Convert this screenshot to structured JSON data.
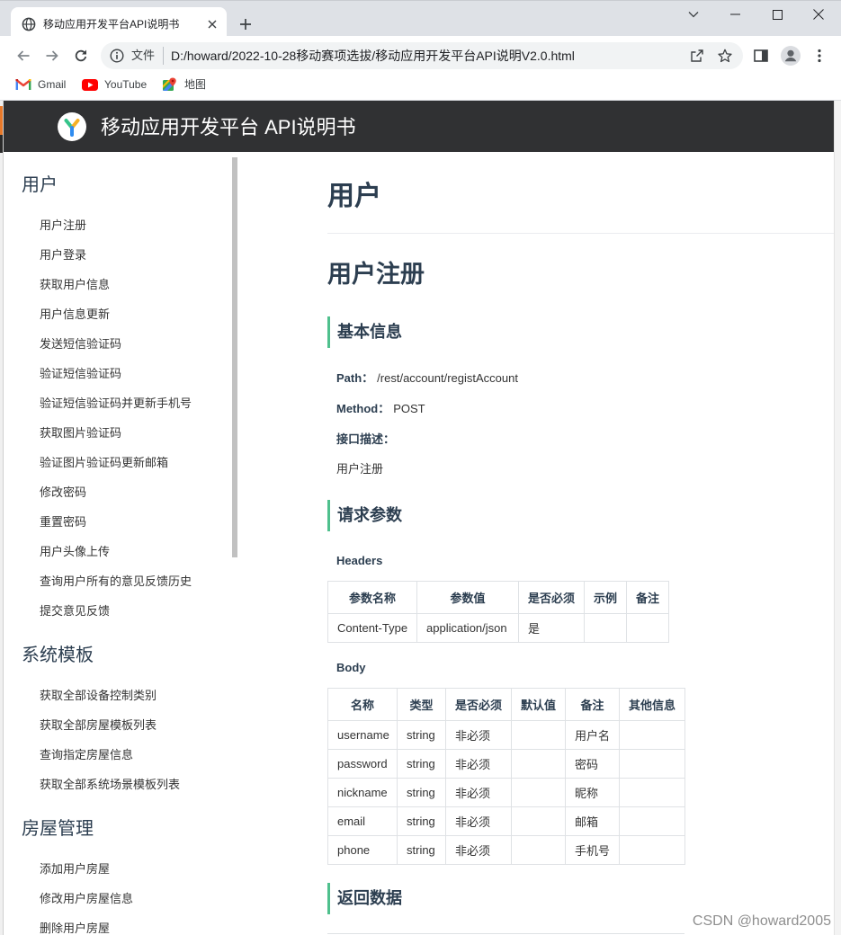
{
  "browser": {
    "tab": {
      "title": "移动应用开发平台API说明书",
      "icon": "globe-icon"
    },
    "address_bar": {
      "scheme_label": "文件",
      "url": "D:/howard/2022-10-28移动赛项选拔/移动应用开发平台API说明V2.0.html"
    },
    "bookmarks": [
      {
        "label": "Gmail",
        "icon": "gmail-icon"
      },
      {
        "label": "YouTube",
        "icon": "youtube-icon"
      },
      {
        "label": "地图",
        "icon": "maps-icon"
      }
    ]
  },
  "header": {
    "title": "移动应用开发平台 API说明书",
    "logo": "yapi-logo-icon"
  },
  "sidebar": {
    "sections": [
      {
        "title": "用户",
        "items": [
          "用户注册",
          "用户登录",
          "获取用户信息",
          "用户信息更新",
          "发送短信验证码",
          "验证短信验证码",
          "验证短信验证码并更新手机号",
          "获取图片验证码",
          "验证图片验证码更新邮箱",
          "修改密码",
          "重置密码",
          "用户头像上传",
          "查询用户所有的意见反馈历史",
          "提交意见反馈"
        ]
      },
      {
        "title": "系统模板",
        "items": [
          "获取全部设备控制类别",
          "获取全部房屋模板列表",
          "查询指定房屋信息",
          "获取全部系统场景模板列表"
        ]
      },
      {
        "title": "房屋管理",
        "items": [
          "添加用户房屋",
          "修改用户房屋信息",
          "删除用户房屋"
        ]
      }
    ]
  },
  "main": {
    "category_title": "用户",
    "api_title": "用户注册",
    "basic_info": {
      "heading": "基本信息",
      "path_label": "Path：",
      "path": "/rest/account/registAccount",
      "method_label": "Method：",
      "method": "POST",
      "desc_label": "接口描述：",
      "desc": "用户注册"
    },
    "request": {
      "heading": "请求参数",
      "headers_label": "Headers",
      "headers_table": {
        "columns": [
          "参数名称",
          "参数值",
          "是否必须",
          "示例",
          "备注"
        ],
        "rows": [
          [
            "Content-Type",
            "application/json",
            "是",
            "",
            ""
          ]
        ]
      },
      "body_label": "Body",
      "body_table": {
        "columns": [
          "名称",
          "类型",
          "是否必须",
          "默认值",
          "备注",
          "其他信息"
        ],
        "rows": [
          [
            "username",
            "string",
            "非必须",
            "",
            "用户名",
            ""
          ],
          [
            "password",
            "string",
            "非必须",
            "",
            "密码",
            ""
          ],
          [
            "nickname",
            "string",
            "非必须",
            "",
            "昵称",
            ""
          ],
          [
            "email",
            "string",
            "非必须",
            "",
            "邮箱",
            ""
          ],
          [
            "phone",
            "string",
            "非必须",
            "",
            "手机号",
            ""
          ]
        ]
      }
    },
    "response": {
      "heading": "返回数据"
    }
  },
  "watermark": "CSDN @howard2005",
  "colors": {
    "header_bg": "#303133",
    "accent_green": "#4fc08d",
    "youtube_red": "#ff0000"
  }
}
